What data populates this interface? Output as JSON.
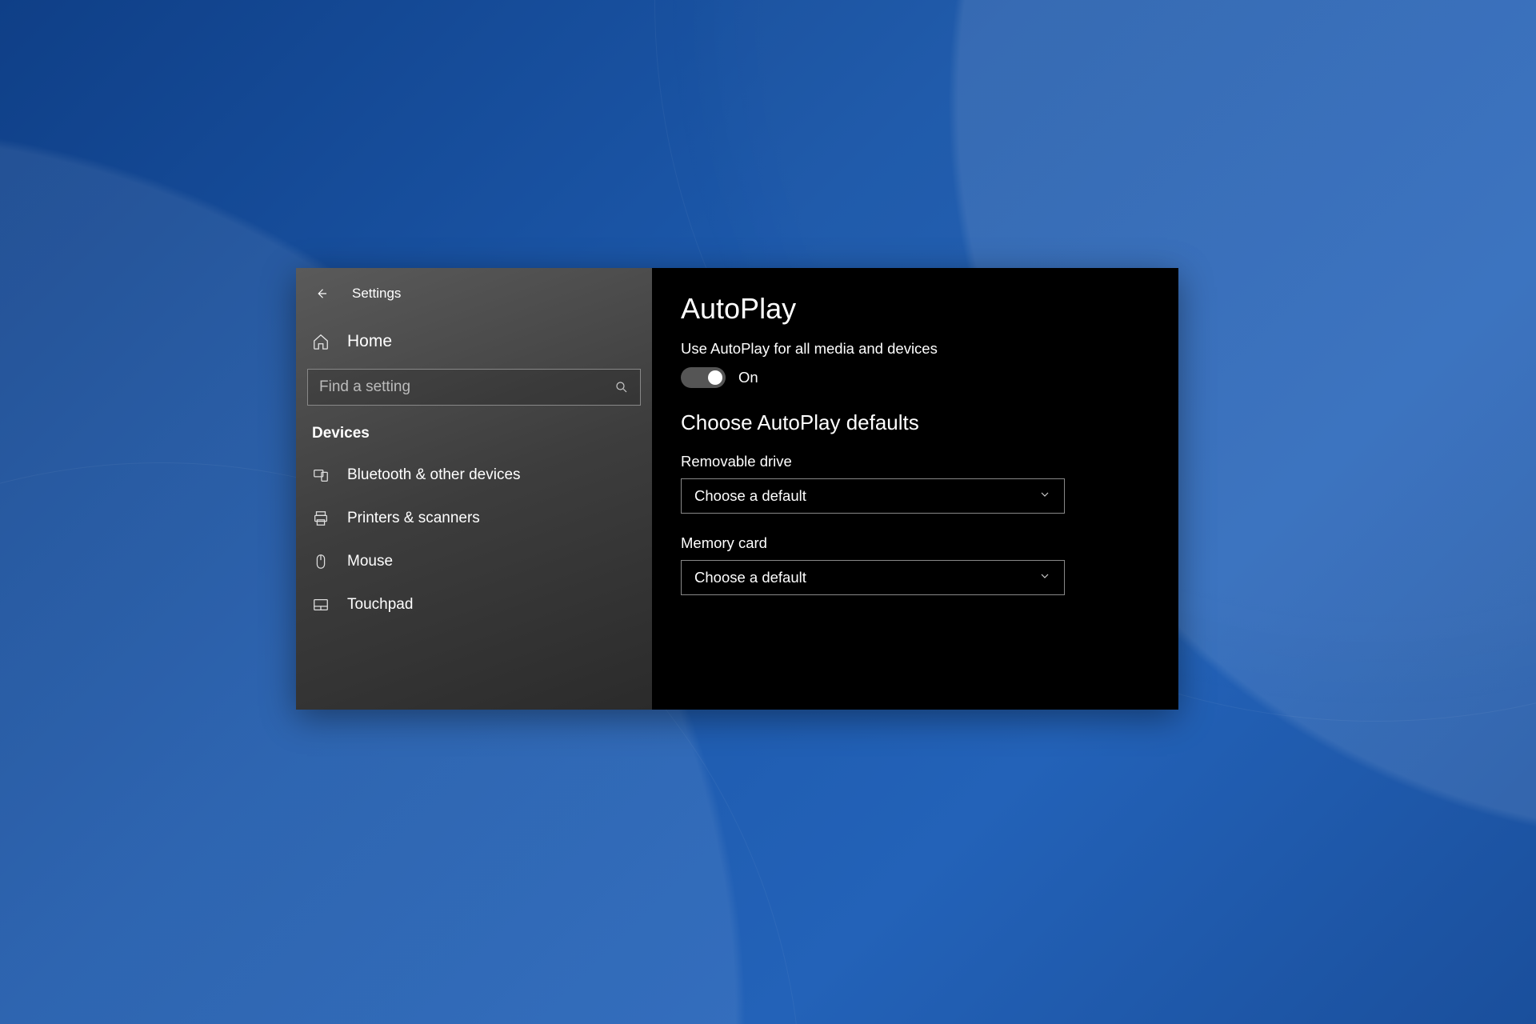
{
  "header": {
    "title": "Settings"
  },
  "sidebar": {
    "home_label": "Home",
    "search_placeholder": "Find a setting",
    "section_label": "Devices",
    "items": [
      {
        "label": "Bluetooth & other devices"
      },
      {
        "label": "Printers & scanners"
      },
      {
        "label": "Mouse"
      },
      {
        "label": "Touchpad"
      }
    ]
  },
  "main": {
    "title": "AutoPlay",
    "toggle_desc": "Use AutoPlay for all media and devices",
    "toggle_state": "On",
    "defaults_heading": "Choose AutoPlay defaults",
    "removable_label": "Removable drive",
    "removable_value": "Choose a default",
    "memorycard_label": "Memory card",
    "memorycard_value": "Choose a default"
  }
}
